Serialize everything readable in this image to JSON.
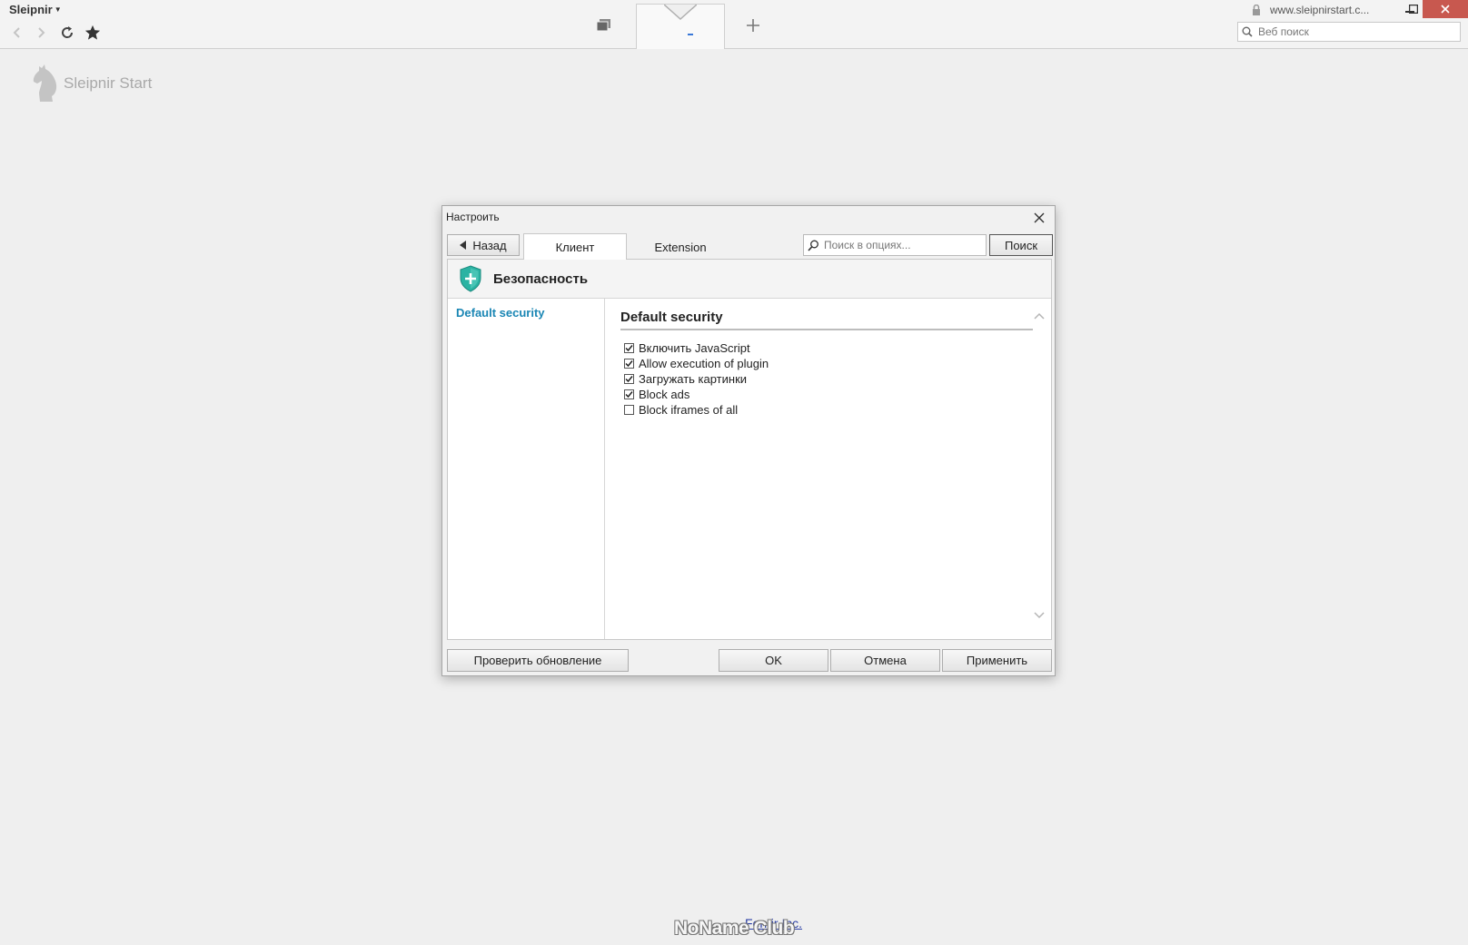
{
  "browser": {
    "app_menu": "Sleipnir",
    "url": "www.sleipnirstart.c...",
    "websearch_placeholder": "Веб поиск"
  },
  "start_page": {
    "brand": "Sleipnir Start"
  },
  "dialog": {
    "title": "Настроить",
    "back_label": "Назад",
    "tabs": [
      {
        "label": "Клиент",
        "selected": true
      },
      {
        "label": "Extension",
        "selected": false
      }
    ],
    "search_placeholder": "Поиск в опциях...",
    "search_button": "Поиск",
    "section_title": "Безопасность",
    "nav_items": [
      {
        "label": "Default security",
        "selected": true
      }
    ],
    "group_title": "Default security",
    "options": [
      {
        "label": "Включить JavaScript",
        "checked": true
      },
      {
        "label": "Allow execution of plugin",
        "checked": true
      },
      {
        "label": "Загружать картинки",
        "checked": true
      },
      {
        "label": "Block ads",
        "checked": true
      },
      {
        "label": "Block iframes of all",
        "checked": false
      }
    ],
    "buttons": {
      "check_update": "Проверить обновление",
      "ok": "OK",
      "cancel": "Отмена",
      "apply": "Применить"
    }
  },
  "footer": {
    "link_text": "Fenrir Inc.",
    "watermark": "NoName Club"
  },
  "colors": {
    "accent": "#1a86b4",
    "shield": "#2bb3a3",
    "close_button": "#c8584f"
  }
}
